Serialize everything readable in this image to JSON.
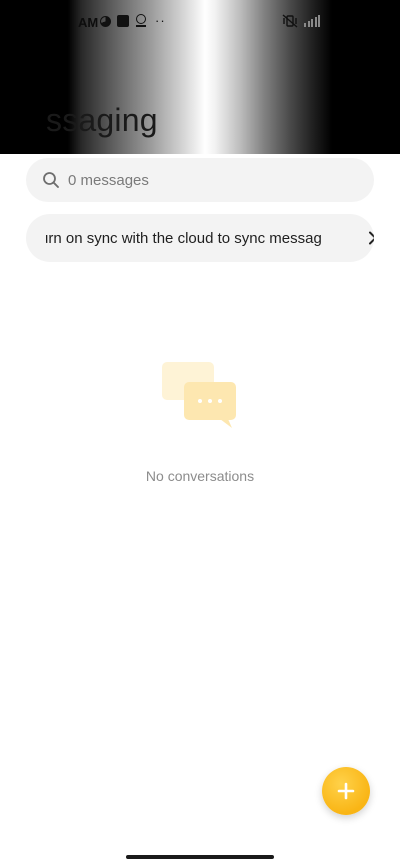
{
  "status_bar": {
    "time": "AM"
  },
  "header": {
    "title": "ssaging"
  },
  "search": {
    "placeholder": "0 messages"
  },
  "sync_banner": {
    "text": "urn on sync with the cloud to sync messag"
  },
  "empty_state": {
    "text": "No conversations"
  },
  "colors": {
    "accent": "#f9b515",
    "empty_icon": "#fde7b0",
    "surface": "#f3f3f3"
  },
  "icons": {
    "search": "search-icon",
    "chevron": "chevron-right-icon",
    "empty": "chat-bubbles-icon",
    "fab": "plus-icon"
  }
}
